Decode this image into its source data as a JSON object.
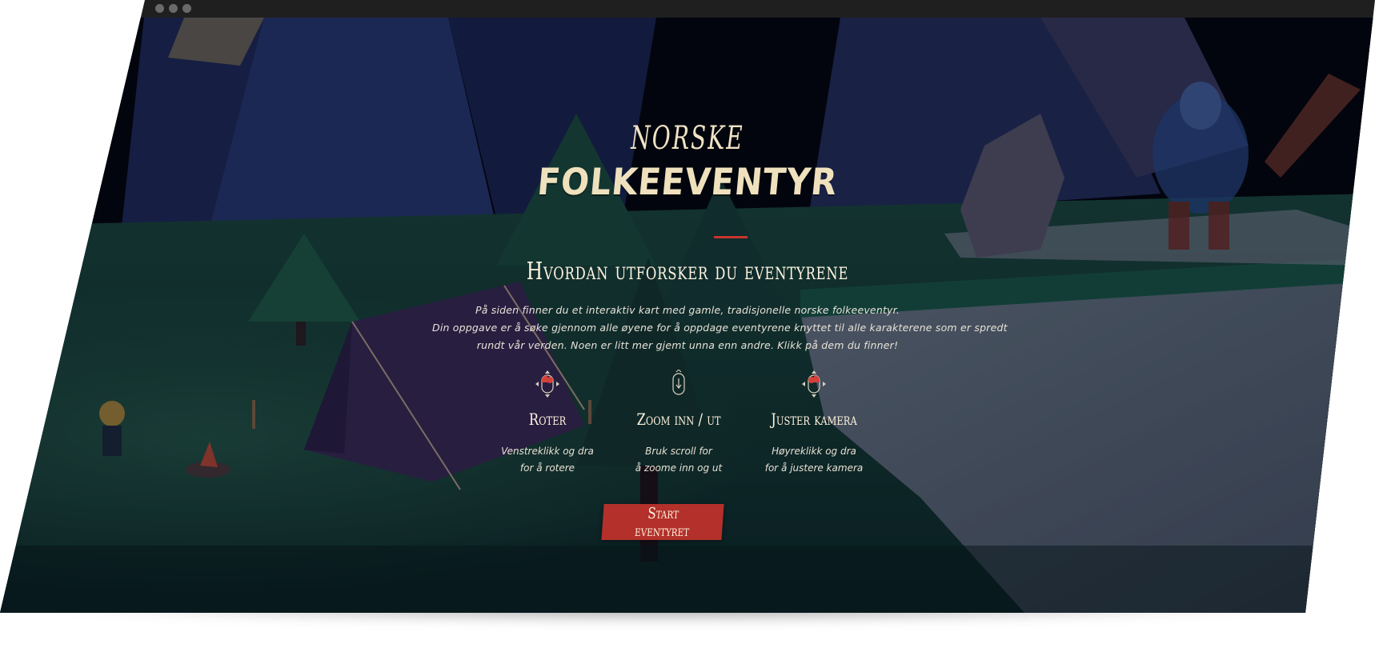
{
  "window": {
    "traffic_lights": [
      "close",
      "minimize",
      "maximize"
    ]
  },
  "hero": {
    "title_line1": "NORSKE",
    "title_line2": "FOLKEEVENTYR",
    "accent_color": "#c8342f"
  },
  "instructions": {
    "heading": "Hvordan utforsker du eventyrene",
    "paragraph_lines": [
      "På siden finner du et interaktiv kart med gamle, tradisjonelle norske folkeeventyr.",
      "Din oppgave er å søke gjennom alle øyene for å oppdage eventyrene knyttet til alle karakterene som er spredt",
      "rundt vår verden. Noen er litt mer gjemt unna enn andre. Klikk på dem du finner!"
    ]
  },
  "controls": [
    {
      "icon": "mouse-left-drag-icon",
      "label": "Roter",
      "desc_lines": [
        "Venstreklikk og dra",
        "for å rotere"
      ]
    },
    {
      "icon": "mouse-scroll-icon",
      "label": "Zoom inn / ut",
      "desc_lines": [
        "Bruk scroll for",
        "å zoome inn og ut"
      ]
    },
    {
      "icon": "mouse-right-drag-icon",
      "label": "Juster kamera",
      "desc_lines": [
        "Høyreklikk og dra",
        "for å justere kamera"
      ]
    }
  ],
  "cta": {
    "label": "Start eventyret",
    "color": "#b3302b"
  }
}
